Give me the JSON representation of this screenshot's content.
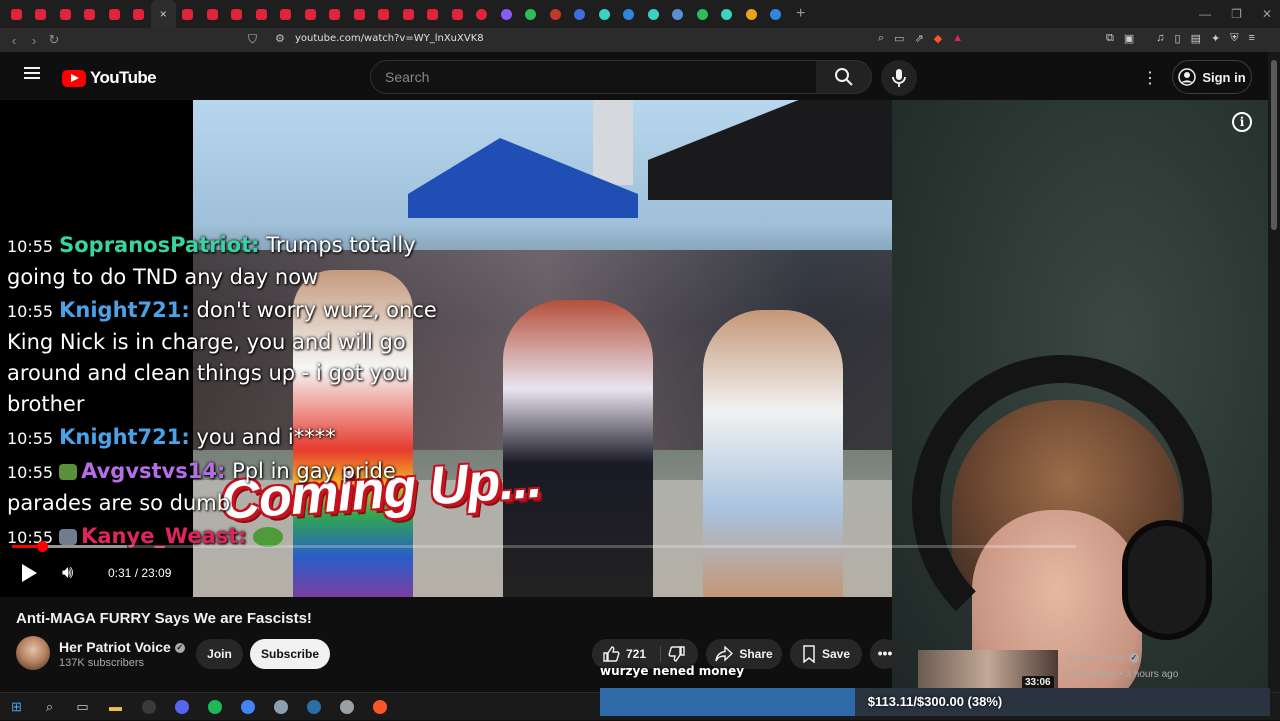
{
  "browser": {
    "tab_count": 32,
    "url": "youtube.com/watch?v=WY_lnXuXVK8",
    "close_tab_glyph": "×",
    "new_tab_glyph": "+"
  },
  "youtube": {
    "logo_text": "YouTube",
    "search_placeholder": "Search",
    "signin_label": "Sign in"
  },
  "video": {
    "title": "Anti-MAGA FURRY Says We are Fascists!",
    "overlay_text": "Coming Up...",
    "current_time": "0:31 / 23:09",
    "progress_played": 0.028,
    "progress_buffered": 0.108
  },
  "chat": [
    {
      "time": "10:55",
      "name": "SopranosPatriot:",
      "name_color": "#3ad29f",
      "text": "Trumps totally going to do TND any day now",
      "badge": false
    },
    {
      "time": "10:55",
      "name": "Knight721:",
      "name_color": "#4aa3e8",
      "text": "don't worry wurz, once King Nick is in charge, you and will go around and clean things up - i got you brother",
      "badge": false
    },
    {
      "time": "10:55",
      "name": "Knight721:",
      "name_color": "#4aa3e8",
      "text": "you and i****",
      "badge": false
    },
    {
      "time": "10:55",
      "name": "Avgvstvs14:",
      "name_color": "#b56ee6",
      "text": "Ppl in gay pride parades are so dumb",
      "badge": true,
      "badge_color": "#5b8f3a"
    },
    {
      "time": "10:55",
      "name": "Kanye_Weast:",
      "name_color": "#e0245e",
      "text": "",
      "badge": true,
      "badge_color": "#6f7d8f"
    }
  ],
  "channel": {
    "name": "Her Patriot Voice",
    "subscribers": "137K subscribers",
    "join_label": "Join",
    "subscribe_label": "Subscribe"
  },
  "actions": {
    "like_count": "721",
    "share_label": "Share",
    "save_label": "Save"
  },
  "recommendation": {
    "duration": "33:06",
    "channel": "Skeeter Jean",
    "meta": "118K views • 3 hours ago"
  },
  "stream_overlay": {
    "message": "wurzye nened money",
    "goal_text": "$113.11/$300.00 (38%)",
    "goal_fraction": 0.38
  },
  "taskbar": {
    "icons": [
      "windows-icon",
      "search-icon",
      "task-view-icon",
      "file-explorer-icon",
      "obs-icon",
      "discord-icon",
      "spotify-icon",
      "chrome-icon",
      "app-icon",
      "steam-icon",
      "app2-icon",
      "brave-icon"
    ]
  },
  "colors": {
    "youtube_red": "#ff0000",
    "background": "#0f0f0f"
  }
}
